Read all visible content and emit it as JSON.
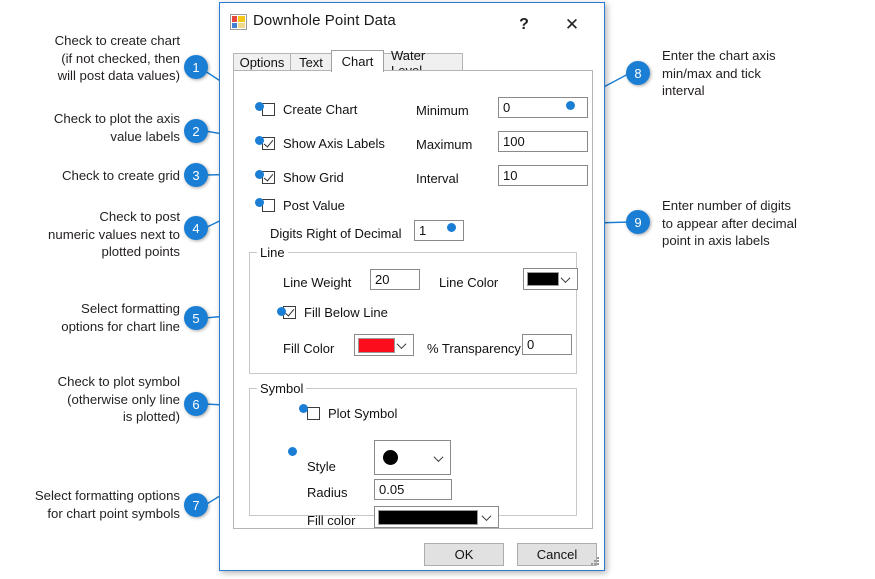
{
  "dialog": {
    "title": "Downhole Point Data",
    "icon": "app-window-icon",
    "help_label": "?",
    "close_label": "✕",
    "tabs": [
      {
        "label": "Options",
        "selected": false
      },
      {
        "label": "Text",
        "selected": false
      },
      {
        "label": "Chart",
        "selected": true
      },
      {
        "label": "Water Level",
        "selected": false
      }
    ],
    "checkboxes": {
      "create_chart": {
        "label": "Create Chart",
        "checked": false
      },
      "show_axis_labels": {
        "label": "Show Axis Labels",
        "checked": true
      },
      "show_grid": {
        "label": "Show Grid",
        "checked": true
      },
      "post_value": {
        "label": "Post Value",
        "checked": false
      },
      "fill_below_line": {
        "label": "Fill Below Line",
        "checked": true
      },
      "plot_symbol": {
        "label": "Plot Symbol",
        "checked": false
      }
    },
    "axis": {
      "minimum_label": "Minimum",
      "minimum_value": "0",
      "maximum_label": "Maximum",
      "maximum_value": "100",
      "interval_label": "Interval",
      "interval_value": "10"
    },
    "digits": {
      "label": "Digits Right of Decimal",
      "value": "1"
    },
    "line_group": {
      "title": "Line",
      "line_weight_label": "Line Weight",
      "line_weight_value": "20",
      "line_color_label": "Line Color",
      "line_color_value": "#000000",
      "fill_color_label": "Fill Color",
      "fill_color_value": "#fc0d1b",
      "transparency_label": "% Transparency",
      "transparency_value": "0"
    },
    "symbol_group": {
      "title": "Symbol",
      "style_label": "Style",
      "style_symbol": "filled-circle",
      "radius_label": "Radius",
      "radius_value": "0.05",
      "fill_color_label": "Fill color",
      "fill_color_value": "#000000"
    },
    "buttons": {
      "ok": "OK",
      "cancel": "Cancel"
    }
  },
  "callouts": [
    {
      "num": "1",
      "text": "Check to create chart\n(if not checked, then\nwill post data values)"
    },
    {
      "num": "2",
      "text": "Check to plot the axis\nvalue labels"
    },
    {
      "num": "3",
      "text": "Check to create grid"
    },
    {
      "num": "4",
      "text": "Check to post\nnumeric values next to\nplotted points"
    },
    {
      "num": "5",
      "text": "Select formatting\noptions for chart line"
    },
    {
      "num": "6",
      "text": "Check to plot symbol\n(otherwise only line\nis plotted)"
    },
    {
      "num": "7",
      "text": "Select formatting options\nfor chart point symbols"
    },
    {
      "num": "8",
      "text": "Enter the chart axis\nmin/max and tick\ninterval"
    },
    {
      "num": "9",
      "text": "Enter number of digits\nto appear after decimal\npoint in axis labels"
    }
  ],
  "colors": {
    "accent": "#1a7fd4",
    "dialog_border": "#2a7ad2",
    "text": "#231f20"
  }
}
